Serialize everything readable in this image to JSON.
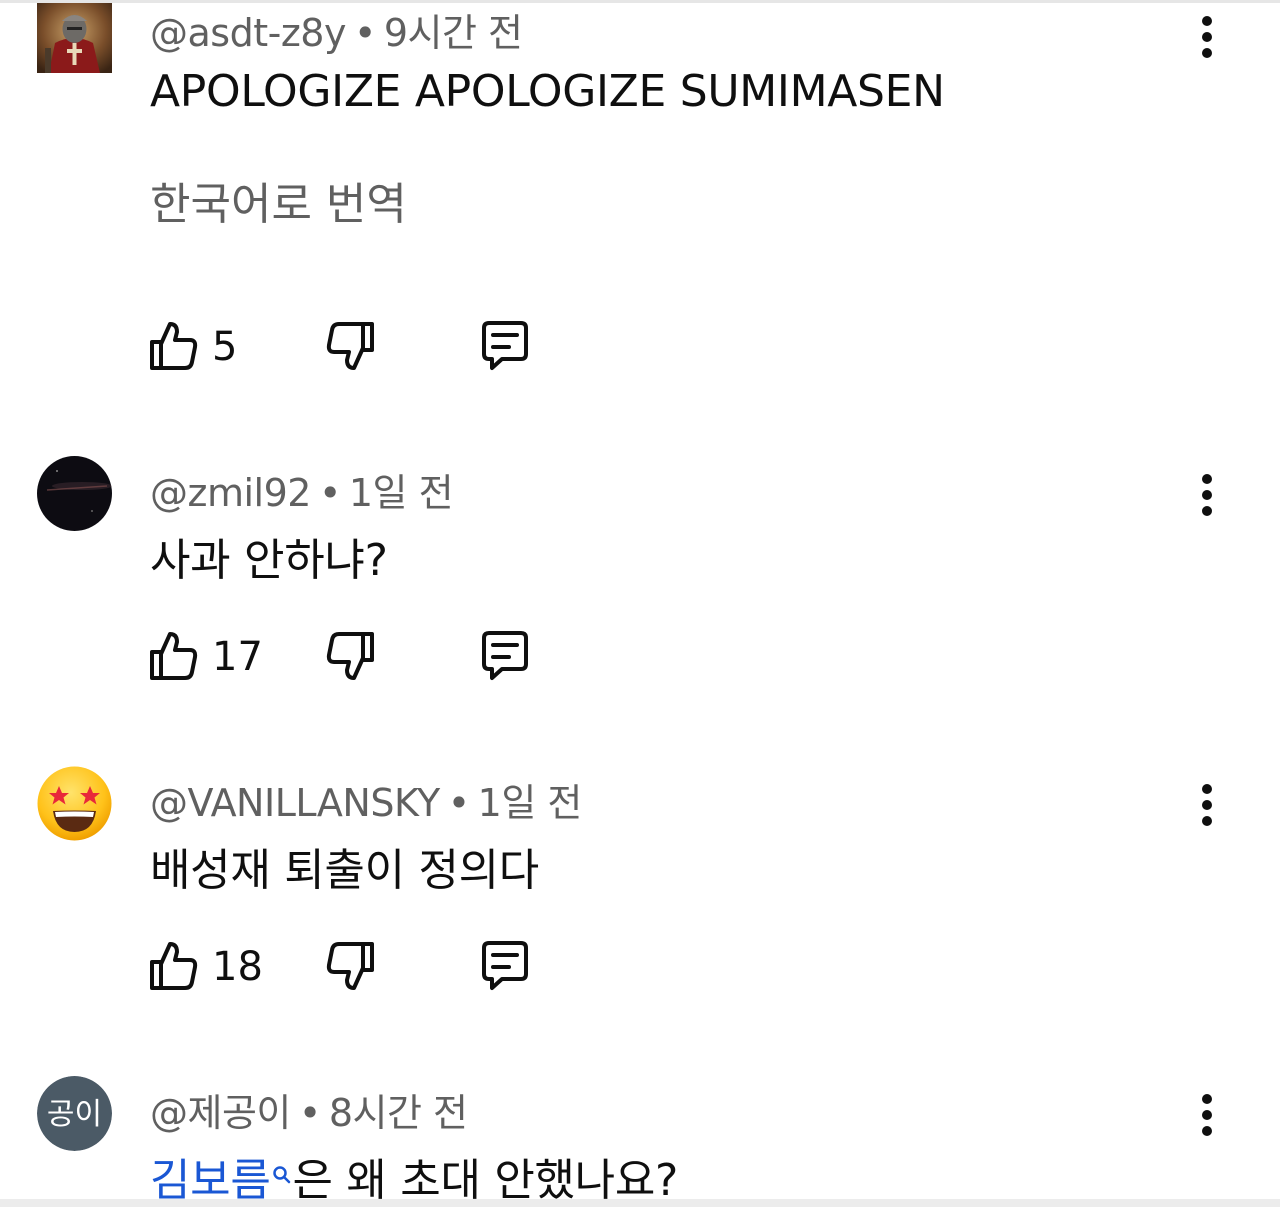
{
  "comments": [
    {
      "author": "@asdt-z8y",
      "separator": "•",
      "time": "9시간 전",
      "text": "APOLOGIZE APOLOGIZE SUMIMASEN",
      "translate_label": "한국어로 번역",
      "likes": "5",
      "avatar_icon": "knight-avatar-icon"
    },
    {
      "author": "@zmil92",
      "separator": "•",
      "time": "1일 전",
      "text": "사과 안하냐?",
      "likes": "17",
      "avatar_icon": "dark-space-avatar-icon"
    },
    {
      "author": "@VANILLANSKY",
      "separator": "•",
      "time": "1일 전",
      "text": "배성재 퇴출이 정의다",
      "likes": "18",
      "avatar_icon": "star-eyes-emoji-avatar-icon"
    },
    {
      "author": "@제공이",
      "separator": "•",
      "time": "8시간 전",
      "mention": "김보름",
      "text_after_mention": "은 왜 초대 안했나요?",
      "avatar_initials": "공이",
      "avatar_color": "#4b5a66"
    }
  ],
  "colors": {
    "meta_text": "#606060",
    "body_text": "#0f0f0f",
    "mention": "#1a57d4"
  }
}
